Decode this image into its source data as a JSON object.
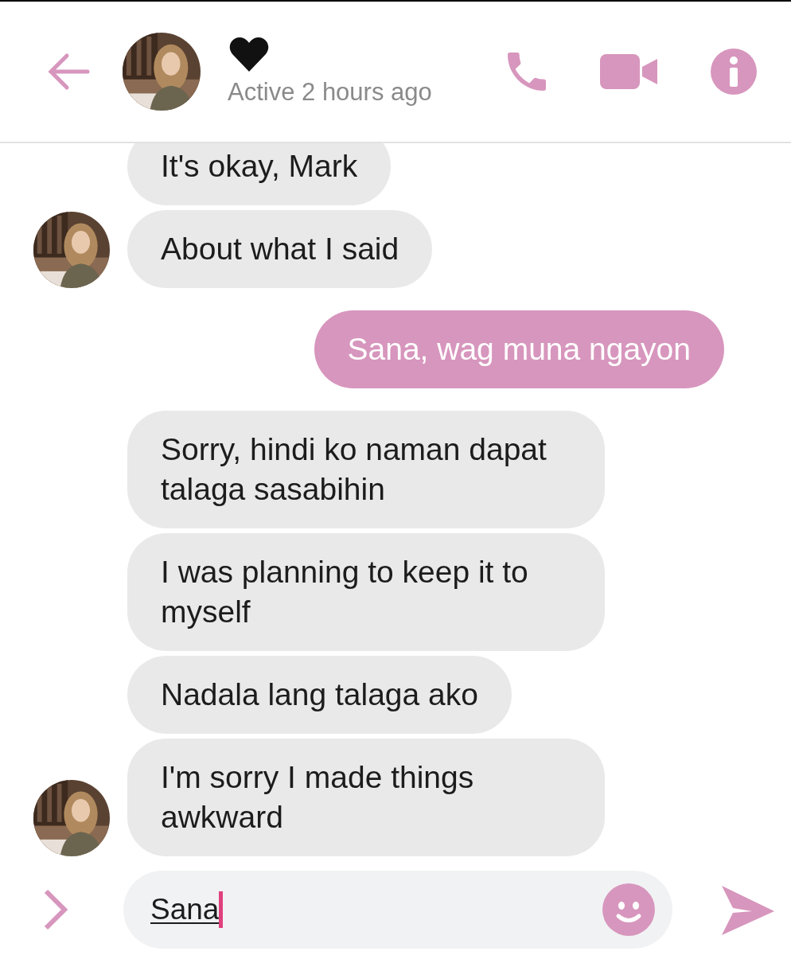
{
  "header": {
    "status": "Active 2 hours ago"
  },
  "messages": [
    {
      "text": "It's okay, Mark",
      "kind": "received",
      "avatar": false
    },
    {
      "text": "About what I said",
      "kind": "received",
      "avatar": true
    },
    {
      "text": "Sana, wag muna ngayon",
      "kind": "sent",
      "avatar": false
    },
    {
      "text": "Sorry, hindi ko naman dapat talaga sasabihin",
      "kind": "received",
      "avatar": false
    },
    {
      "text": "I was planning to keep it to myself",
      "kind": "received",
      "avatar": false
    },
    {
      "text": "Nadala lang talaga ako",
      "kind": "received",
      "avatar": false
    },
    {
      "text": "I'm sorry I made things awkward",
      "kind": "received",
      "avatar": true
    }
  ],
  "composer": {
    "value": "Sana"
  }
}
